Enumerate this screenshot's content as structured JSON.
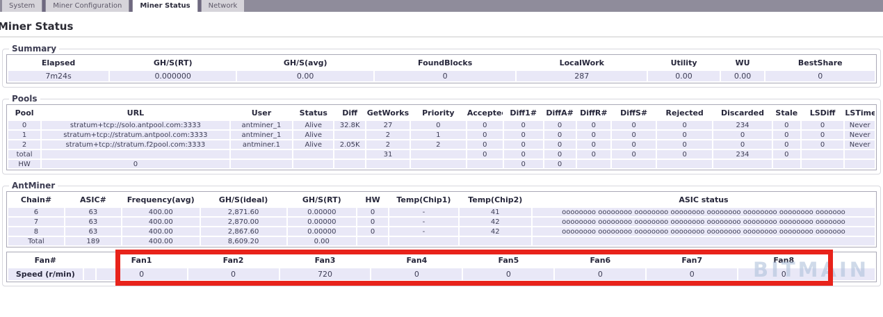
{
  "colors": {
    "top_bar": "#8f8c9b",
    "tab_inactive_bg": "#d6d4da",
    "row_lavender": "#e9e8f7",
    "highlight_red": "#e8231b"
  },
  "tabbar": {
    "tabs": [
      {
        "label": "System",
        "active": false
      },
      {
        "label": "Miner Configuration",
        "active": false
      },
      {
        "label": "Miner Status",
        "active": true
      },
      {
        "label": "Network",
        "active": false
      }
    ]
  },
  "page_title": "Miner Status",
  "summary": {
    "legend": "Summary",
    "table": {
      "headers": [
        "Elapsed",
        "GH/S(RT)",
        "GH/S(avg)",
        "FoundBlocks",
        "LocalWork",
        "Utility",
        "WU",
        "BestShare"
      ],
      "rows": [
        [
          "7m24s",
          "0.000000",
          "0.00",
          "0",
          "287",
          "0.00",
          "0.00",
          "0"
        ]
      ]
    }
  },
  "pools": {
    "legend": "Pools",
    "table": {
      "headers": [
        "Pool",
        "URL",
        "User",
        "Status",
        "Diff",
        "GetWorks",
        "Priority",
        "Accepted",
        "Diff1#",
        "DiffA#",
        "DiffR#",
        "DiffS#",
        "Rejected",
        "Discarded",
        "Stale",
        "LSDiff",
        "LSTime"
      ],
      "rows": [
        [
          "0",
          "stratum+tcp://solo.antpool.com:3333",
          "antminer_1",
          "Alive",
          "32.8K",
          "27",
          "0",
          "0",
          "0",
          "0",
          "0",
          "0",
          "0",
          "234",
          "0",
          "0",
          "Never"
        ],
        [
          "1",
          "stratum+tcp://stratum.antpool.com:3333",
          "antminer_1",
          "Alive",
          "",
          "2",
          "1",
          "0",
          "0",
          "0",
          "0",
          "0",
          "0",
          "0",
          "0",
          "0",
          "Never"
        ],
        [
          "2",
          "stratum+tcp://stratum.f2pool.com:3333",
          "antminer.1",
          "Alive",
          "2.05K",
          "2",
          "2",
          "0",
          "0",
          "0",
          "0",
          "0",
          "0",
          "0",
          "0",
          "0",
          "Never"
        ],
        [
          "total",
          "",
          "",
          "",
          "",
          "31",
          "",
          "0",
          "0",
          "0",
          "0",
          "0",
          "0",
          "234",
          "0",
          "",
          ""
        ],
        [
          "HW",
          "0",
          "",
          "",
          "",
          "",
          "",
          "",
          "0",
          "0",
          "",
          "",
          "",
          "",
          "",
          "",
          ""
        ]
      ]
    }
  },
  "antminer": {
    "legend": "AntMiner",
    "chains_table": {
      "headers": [
        "Chain#",
        "ASIC#",
        "Frequency(avg)",
        "GH/S(ideal)",
        "GH/S(RT)",
        "HW",
        "Temp(Chip1)",
        "Temp(Chip2)",
        "ASIC status"
      ],
      "rows": [
        [
          "6",
          "63",
          "400.00",
          "2,871.60",
          "0.00000",
          "0",
          "-",
          "41",
          "oooooooo oooooooo oooooooo oooooooo oooooooo oooooooo oooooooo ooooooo"
        ],
        [
          "7",
          "63",
          "400.00",
          "2,870.00",
          "0.00000",
          "0",
          "-",
          "42",
          "oooooooo oooooooo oooooooo oooooooo oooooooo oooooooo oooooooo ooooooo"
        ],
        [
          "8",
          "63",
          "400.00",
          "2,867.60",
          "0.00000",
          "0",
          "-",
          "42",
          "oooooooo oooooooo oooooooo oooooooo oooooooo oooooooo oooooooo ooooooo"
        ],
        [
          "Total",
          "189",
          "400.00",
          "8,609.20",
          "0.00",
          "",
          "",
          "",
          ""
        ]
      ]
    },
    "fans_table": {
      "headers": [
        "Fan#",
        "",
        "Fan1",
        "Fan2",
        "Fan3",
        "Fan4",
        "Fan5",
        "Fan6",
        "Fan7",
        "Fan8",
        ""
      ],
      "rows": [
        [
          "Speed (r/min)",
          "",
          "0",
          "0",
          "720",
          "0",
          "0",
          "0",
          "0",
          "0",
          ""
        ]
      ]
    }
  },
  "watermark": "BITMAIN"
}
